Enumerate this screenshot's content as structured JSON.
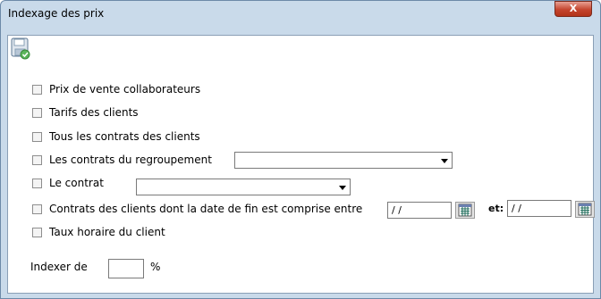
{
  "window": {
    "title": "Indexage des prix",
    "close_label": "X"
  },
  "toolbar": {
    "save_icon": "floppy-disk-save-icon"
  },
  "options": {
    "prix_vente": "Prix de vente collaborateurs",
    "tarifs_clients": "Tarifs des clients",
    "tous_contrats": "Tous les contrats des clients",
    "contrats_regroupement": "Les contrats du regroupement",
    "le_contrat": "Le contrat",
    "contrats_date_fin": "Contrats des clients dont la date de fin est comprise entre",
    "taux_horaire": "Taux horaire du client"
  },
  "dates": {
    "from_value": "/ /",
    "and_label": "et:",
    "to_value": "/ /"
  },
  "index": {
    "label": "Indexer de",
    "value": "",
    "unit": "%"
  },
  "colors": {
    "frame": "#c9daea",
    "close": "#c4452e"
  }
}
